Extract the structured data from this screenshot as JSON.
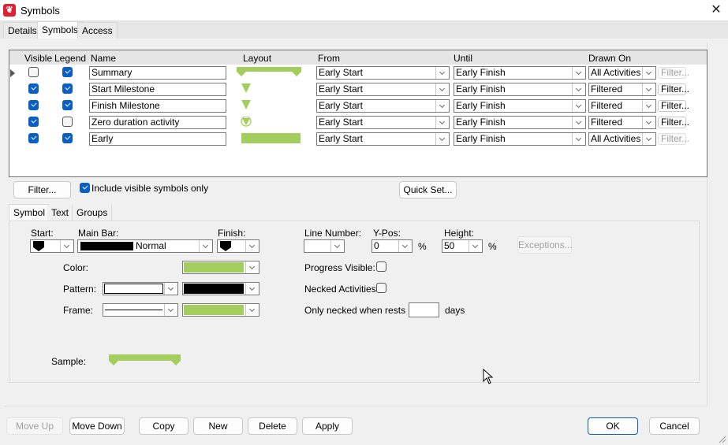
{
  "window": {
    "title": "Symbols",
    "app_icon": "app-logo-icon",
    "close_icon": "close-icon"
  },
  "tabs": [
    {
      "label": "Details"
    },
    {
      "label": "Symbols",
      "active": true
    },
    {
      "label": "Access"
    }
  ],
  "grid": {
    "columns": [
      "Visible",
      "Legend",
      "Name",
      "Layout",
      "From",
      "Until",
      "Drawn On"
    ],
    "rows": [
      {
        "visible": false,
        "legend": true,
        "name": "Summary",
        "layout": "summary-bar",
        "from": "Early Start",
        "until": "Early Finish",
        "drawn_on": "All Activities",
        "filter": "Filter...",
        "filter_enabled": false,
        "current": true
      },
      {
        "visible": true,
        "legend": true,
        "name": "Start Milestone",
        "layout": "triangle-down",
        "from": "Early Start",
        "until": "Early Finish",
        "drawn_on": "Filtered",
        "filter": "Filter...",
        "filter_enabled": true
      },
      {
        "visible": true,
        "legend": true,
        "name": "Finish Milestone",
        "layout": "triangle-down",
        "from": "Early Start",
        "until": "Early Finish",
        "drawn_on": "Filtered",
        "filter": "Filter...",
        "filter_enabled": true
      },
      {
        "visible": true,
        "legend": false,
        "name": "Zero duration activity",
        "layout": "circle-triangle",
        "from": "Early Start",
        "until": "Early Finish",
        "drawn_on": "Filtered",
        "filter": "Filter...",
        "filter_enabled": true
      },
      {
        "visible": true,
        "legend": true,
        "name": "Early",
        "layout": "solid-bar",
        "from": "Early Start",
        "until": "Early Finish",
        "drawn_on": "All Activities",
        "filter": "Filter...",
        "filter_enabled": false
      }
    ]
  },
  "filter_button": "Filter...",
  "include_visible": {
    "label": "Include visible symbols only",
    "checked": true
  },
  "quick_set": "Quick Set...",
  "subtabs": [
    {
      "label": "Symbol",
      "active": true
    },
    {
      "label": "Text"
    },
    {
      "label": "Groups"
    }
  ],
  "symbol": {
    "start_label": "Start:",
    "main_bar_label": "Main Bar:",
    "main_bar_value": "Normal",
    "finish_label": "Finish:",
    "line_number_label": "Line Number:",
    "line_number_value": "",
    "ypos_label": "Y-Pos:",
    "ypos_value": "0",
    "height_label": "Height:",
    "height_value": "50",
    "percent": "%",
    "exceptions": "Exceptions...",
    "color_label": "Color:",
    "pattern_label": "Pattern:",
    "frame_label": "Frame:",
    "progress_label": "Progress Visible:",
    "progress_checked": false,
    "necked_label": "Necked Activities:",
    "necked_checked": false,
    "rests_label": "Only necked when rests >",
    "rests_value": "",
    "days": "days",
    "sample_label": "Sample:"
  },
  "colors": {
    "bar_green": "#a3cd5c",
    "accent_blue": "#0a5fc4",
    "pattern_fg": "#000000"
  },
  "footer": {
    "move_up": "Move Up",
    "move_down": "Move Down",
    "copy": "Copy",
    "new": "New",
    "delete": "Delete",
    "apply": "Apply",
    "ok": "OK",
    "cancel": "Cancel"
  }
}
